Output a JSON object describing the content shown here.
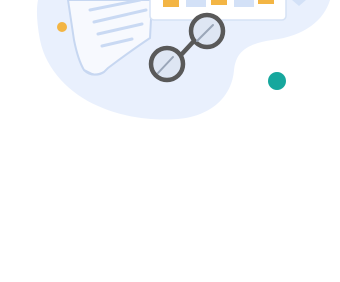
{
  "illustration": {
    "name": "document-review-illustration",
    "icons": {
      "blob": "background-blob",
      "document": "document-icon",
      "chart_card": "bar-chart-card-icon",
      "glasses": "eyeglasses-icon",
      "dot_orange": "orange-dot",
      "dot_teal": "teal-dot"
    },
    "colors": {
      "blob": "#e9f0fd",
      "paper": "#f7f9fe",
      "paper_stroke": "#c7d7f1",
      "paper_lines": "#c9d9f3",
      "card": "#ffffff",
      "bar_orange": "#f3b544",
      "bar_blue": "#d3e1f7",
      "glasses_frame": "#595959",
      "glasses_lens": "#dee6f3",
      "dot_orange": "#f3b544",
      "dot_teal": "#16a79d"
    }
  }
}
